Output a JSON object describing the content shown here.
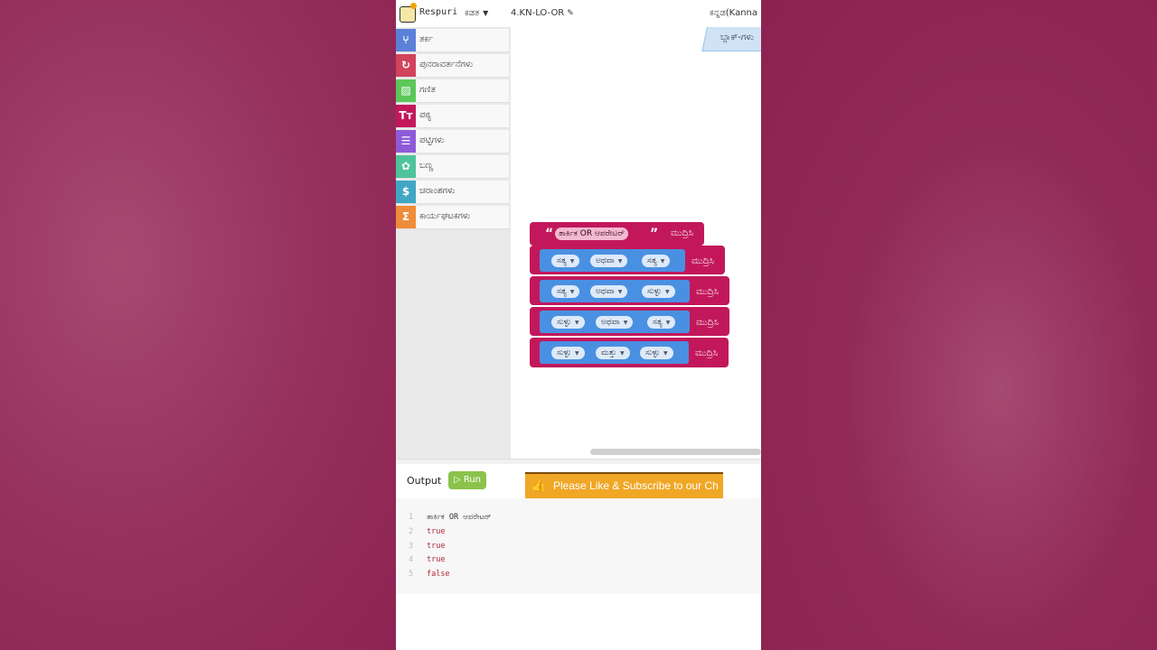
{
  "header": {
    "brand": "Respuri",
    "course_menu": "ಕಡತ",
    "file_title": "4.KN-LO-OR",
    "language": "ಕನ್ನಡ(Kanna"
  },
  "toolbox": {
    "categories": [
      {
        "label": "ತರ್ಕ",
        "icon": "logic-icon",
        "color": "#5b80d8",
        "glyph": "⑂"
      },
      {
        "label": "ಪುನರಾವರ್ತನೆಗಳು",
        "icon": "loop-icon",
        "color": "#d1435a",
        "glyph": "↻"
      },
      {
        "label": "ಗಣಿತ",
        "icon": "math-icon",
        "color": "#5cc75a",
        "glyph": "▨"
      },
      {
        "label": "ಪಠ್ಯ",
        "icon": "text-icon",
        "color": "#c2185b",
        "glyph": "Tт"
      },
      {
        "label": "ಪಟ್ಟಿಗಳು",
        "icon": "list-icon",
        "color": "#8e5bd8",
        "glyph": "☰"
      },
      {
        "label": "ಬಣ್ಣ",
        "icon": "palette-icon",
        "color": "#4fc39a",
        "glyph": "✿"
      },
      {
        "label": "ಚರಾಂಶಗಳು",
        "icon": "variable-icon",
        "color": "#3fa7c4",
        "glyph": "$"
      },
      {
        "label": "ಕಾರ್ಯಘಟಕಗಳು",
        "icon": "function-icon",
        "color": "#ef8c3a",
        "glyph": "Σ"
      }
    ]
  },
  "workspace": {
    "flyout_tab": "ಬ್ಲಾಕ್-ಗಳು",
    "blocks": {
      "print_label": "ಮುದ್ರಿಸಿ",
      "text_block": "ತಾರ್ಕಿಕ OR ಆಪರೇಟರ್",
      "rows": [
        {
          "left": "ಸತ್ಯ",
          "op": "ಅಥವಾ",
          "right": "ಸತ್ಯ"
        },
        {
          "left": "ಸತ್ಯ",
          "op": "ಅಥವಾ",
          "right": "ಸುಳ್ಳು"
        },
        {
          "left": "ಸುಳ್ಳು",
          "op": "ಅಥವಾ",
          "right": "ಸತ್ಯ"
        },
        {
          "left": "ಸುಳ್ಳು",
          "op": "ಮತ್ತು",
          "right": "ಸುಳ್ಳು"
        }
      ]
    }
  },
  "output": {
    "label": "Output",
    "run_label": "▷ Run",
    "banner": "Please Like & Subscribe to our Ch",
    "console_lines": [
      {
        "n": "1",
        "text": "ತಾರ್ಕಿಕ OR ಆಪರೇಟರ್"
      },
      {
        "n": "2",
        "text": "true"
      },
      {
        "n": "3",
        "text": "true"
      },
      {
        "n": "4",
        "text": "true"
      },
      {
        "n": "5",
        "text": "false"
      }
    ]
  }
}
